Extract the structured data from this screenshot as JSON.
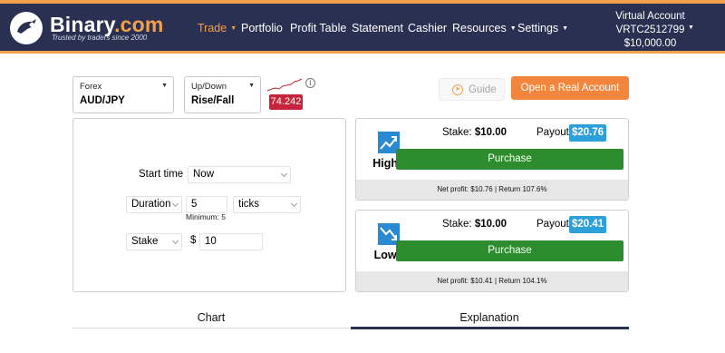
{
  "header": {
    "brand_main": "Binary",
    "brand_suffix": ".com",
    "tagline": "Trusted by traders since 2000",
    "nav": [
      "Trade",
      "Portfolio",
      "Profit Table",
      "Statement",
      "Cashier",
      "Resources",
      "Settings"
    ],
    "account": {
      "type": "Virtual Account",
      "id": "VRTC2512799",
      "balance": "$10,000.00"
    }
  },
  "selectors": {
    "market": {
      "category": "Forex",
      "value": "AUD/JPY"
    },
    "trade_type": {
      "category": "Up/Down",
      "value": "Rise/Fall"
    }
  },
  "price": "74.242",
  "buttons": {
    "guide": "Guide",
    "real_account": "Open a Real Account"
  },
  "form": {
    "start_time_label": "Start time",
    "start_time_value": "Now",
    "duration_label": "Duration",
    "duration_value": "5",
    "duration_unit": "ticks",
    "duration_min": "Minimum: 5",
    "stake_label": "Stake",
    "currency": "$",
    "stake_value": "10"
  },
  "contracts": [
    {
      "name": "Higher",
      "stake_label": "Stake:",
      "stake": "$10.00",
      "payout_label": "Payout:",
      "payout": "$20.76",
      "purchase": "Purchase",
      "net": "Net profit: $10.76 | Return 107.6%",
      "icon": "trend-up-icon"
    },
    {
      "name": "Lower",
      "stake_label": "Stake:",
      "stake": "$10.00",
      "payout_label": "Payout:",
      "payout": "$20.41",
      "purchase": "Purchase",
      "net": "Net profit: $10.41 | Return 104.1%",
      "icon": "trend-down-icon"
    }
  ],
  "tabs": [
    "Chart",
    "Explanation"
  ],
  "colors": {
    "header_bg": "#2a3052",
    "accent": "#f2a14a",
    "buy": "#2d8c2d",
    "payout": "#2ea0d9",
    "price_badge": "#c6243a"
  }
}
